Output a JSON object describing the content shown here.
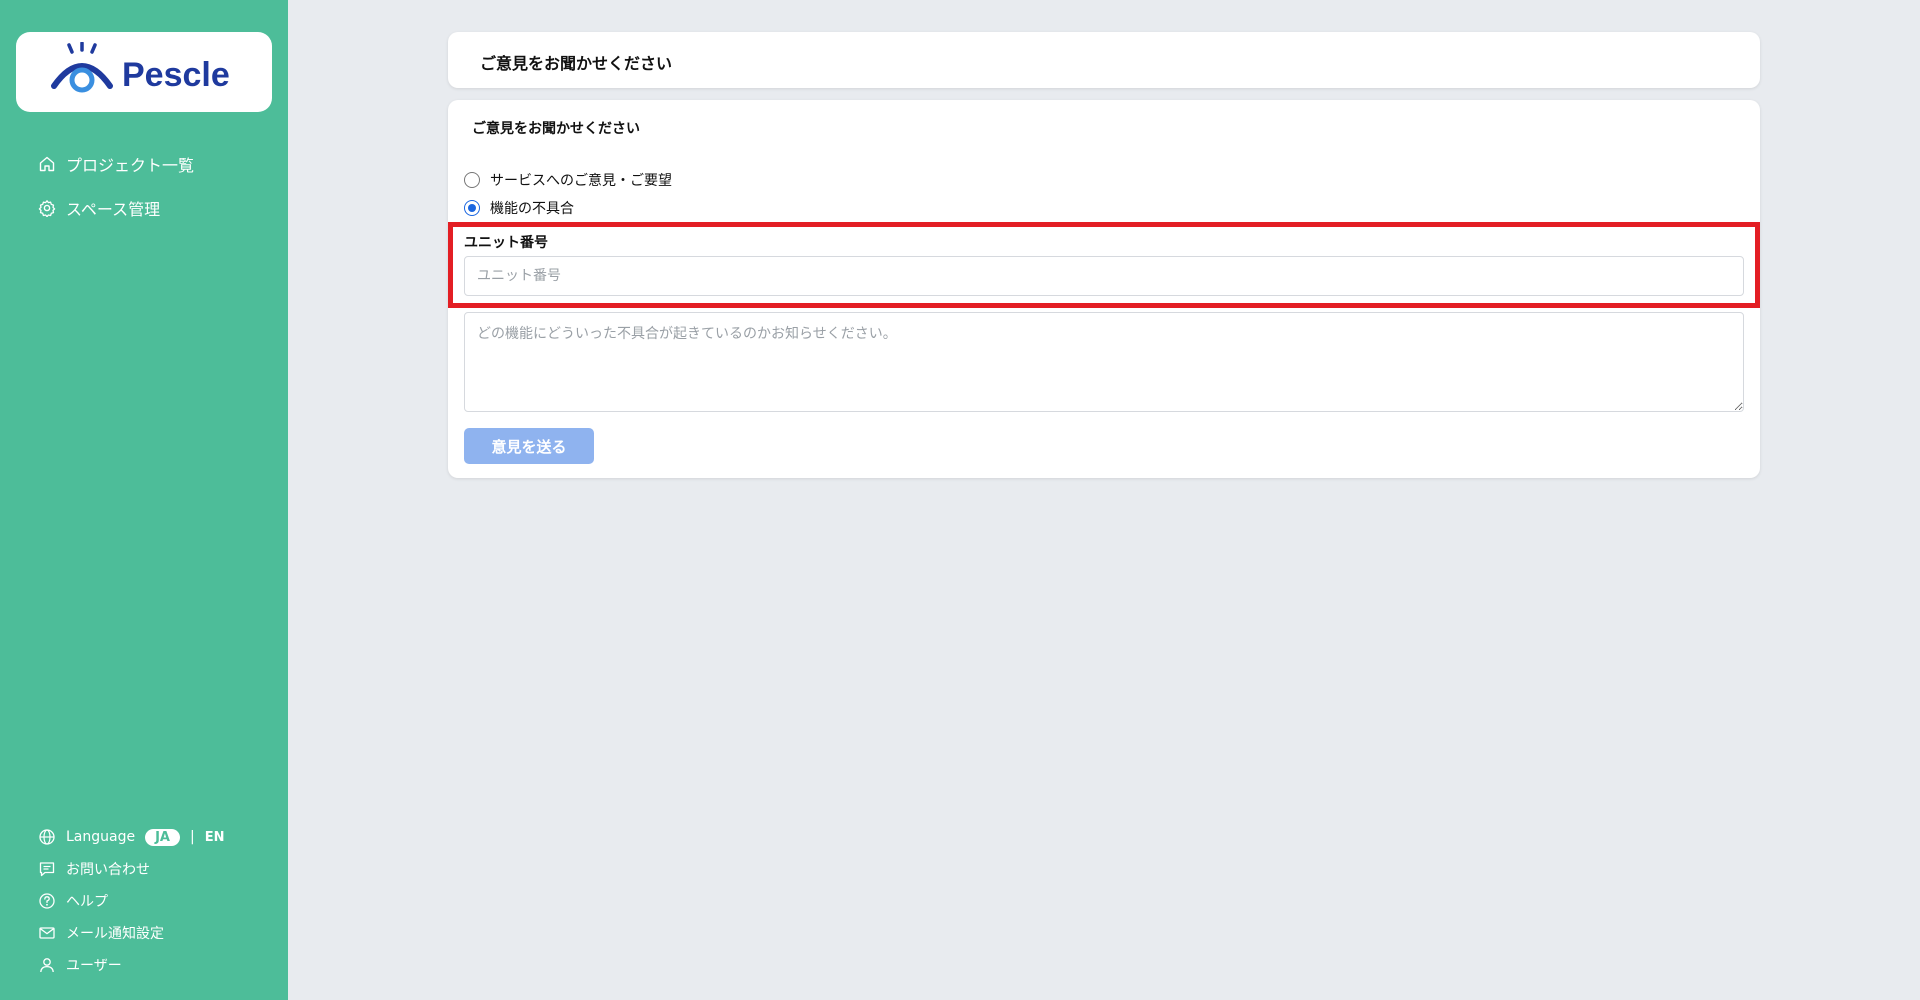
{
  "brand": {
    "name": "Pescle",
    "colors": {
      "sidebar": "#4dbd99",
      "primary_dark": "#1f3a9e",
      "primary_light": "#3a8fe0",
      "button_disabled": "#8fb3ef",
      "highlight": "#e31e24"
    }
  },
  "sidebar": {
    "nav": [
      {
        "label": "プロジェクト一覧",
        "icon": "home-icon"
      },
      {
        "label": "スペース管理",
        "icon": "gear-icon"
      }
    ],
    "language": {
      "label": "Language",
      "options": [
        "JA",
        "EN"
      ],
      "selected": "JA",
      "separator": "|"
    },
    "bottom": [
      {
        "label": "お問い合わせ",
        "icon": "chat-icon"
      },
      {
        "label": "ヘルプ",
        "icon": "help-icon"
      },
      {
        "label": "メール通知設定",
        "icon": "mail-icon"
      },
      {
        "label": "ユーザー",
        "icon": "user-icon"
      }
    ]
  },
  "header": {
    "title": "ご意見をお聞かせください"
  },
  "form": {
    "title": "ご意見をお聞かせください",
    "options": [
      {
        "label": "サービスへのご意見・ご要望",
        "checked": false
      },
      {
        "label": "機能の不具合",
        "checked": true
      }
    ],
    "unit_number": {
      "label": "ユニット番号",
      "placeholder": "ユニット番号",
      "value": ""
    },
    "details": {
      "placeholder": "どの機能にどういった不具合が起きているのかお知らせください。",
      "value": ""
    },
    "submit_label": "意見を送る"
  }
}
